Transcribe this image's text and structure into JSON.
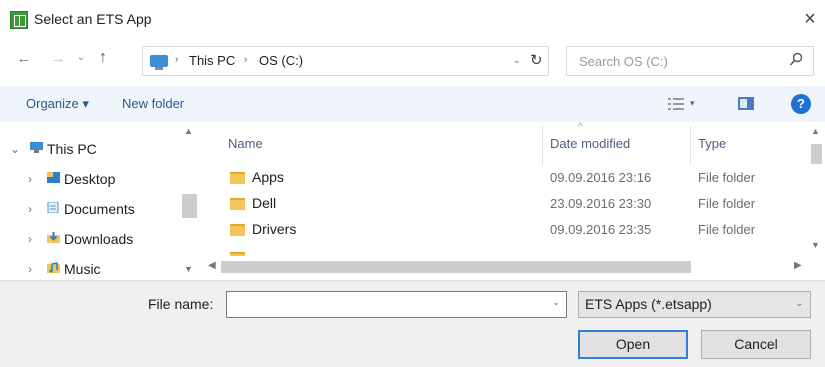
{
  "window": {
    "title": "Select an ETS App",
    "close_glyph": "×"
  },
  "nav": {
    "back": "←",
    "forward": "→",
    "history": "⌄",
    "up": "↑"
  },
  "address": {
    "crumbs": [
      "This PC",
      "OS (C:)"
    ],
    "separator": "›",
    "dropdown": "⌄",
    "refresh": "↻"
  },
  "search": {
    "placeholder": "Search OS (C:)"
  },
  "toolbar": {
    "organize": "Organize ▾",
    "new_folder": "New folder",
    "view_drop": "▾",
    "help": "?"
  },
  "navpane": {
    "items": [
      {
        "label": "This PC",
        "chevron": "⌄",
        "icon": "pc-icon"
      },
      {
        "label": "Desktop",
        "chevron": "›",
        "icon": "desktop-icon"
      },
      {
        "label": "Documents",
        "chevron": "›",
        "icon": "documents-icon"
      },
      {
        "label": "Downloads",
        "chevron": "›",
        "icon": "downloads-icon"
      },
      {
        "label": "Music",
        "chevron": "›",
        "icon": "music-icon"
      }
    ]
  },
  "filelist": {
    "columns": {
      "name": "Name",
      "date": "Date modified",
      "type": "Type"
    },
    "rows": [
      {
        "name": "Apps",
        "date": "09.09.2016 23:16",
        "type": "File folder"
      },
      {
        "name": "Dell",
        "date": "23.09.2016 23:30",
        "type": "File folder"
      },
      {
        "name": "Drivers",
        "date": "09.09.2016 23:35",
        "type": "File folder"
      }
    ]
  },
  "bottom": {
    "filename_label": "File name:",
    "filename_value": "",
    "filter_value": "ETS Apps (*.etsapp)",
    "open": "Open",
    "cancel": "Cancel"
  },
  "colors": {
    "accent": "#2f7fd5",
    "toolbar_bg": "#f0f5fb",
    "app_icon": "#3b9a3a",
    "folder": "#f2c55b"
  }
}
